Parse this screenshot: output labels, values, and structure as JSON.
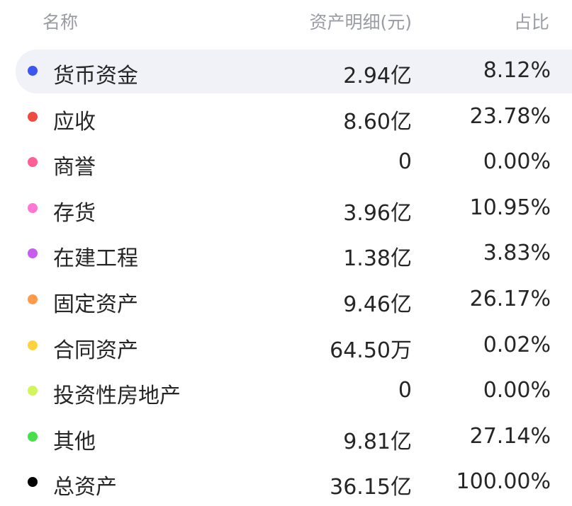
{
  "header": {
    "name": "名称",
    "amount": "资产明细(元)",
    "ratio": "占比"
  },
  "rows": [
    {
      "name": "货币资金",
      "amount": "2.94亿",
      "ratio": "8.12%",
      "color": "#3a57f0",
      "selected": true
    },
    {
      "name": "应收",
      "amount": "8.60亿",
      "ratio": "23.78%",
      "color": "#f2493f",
      "selected": false
    },
    {
      "name": "商誉",
      "amount": "0",
      "ratio": "0.00%",
      "color": "#ff5f96",
      "selected": false
    },
    {
      "name": "存货",
      "amount": "3.96亿",
      "ratio": "10.95%",
      "color": "#ff76d4",
      "selected": false
    },
    {
      "name": "在建工程",
      "amount": "1.38亿",
      "ratio": "3.83%",
      "color": "#c95cf0",
      "selected": false
    },
    {
      "name": "固定资产",
      "amount": "9.46亿",
      "ratio": "26.17%",
      "color": "#ff9a4a",
      "selected": false
    },
    {
      "name": "合同资产",
      "amount": "64.50万",
      "ratio": "0.02%",
      "color": "#ffd33d",
      "selected": false
    },
    {
      "name": "投资性房地产",
      "amount": "0",
      "ratio": "0.00%",
      "color": "#d2f55a",
      "selected": false
    },
    {
      "name": "其他",
      "amount": "9.81亿",
      "ratio": "27.14%",
      "color": "#47e04a",
      "selected": false
    },
    {
      "name": "总资产",
      "amount": "36.15亿",
      "ratio": "100.00%",
      "color": "#000000",
      "selected": false
    }
  ]
}
